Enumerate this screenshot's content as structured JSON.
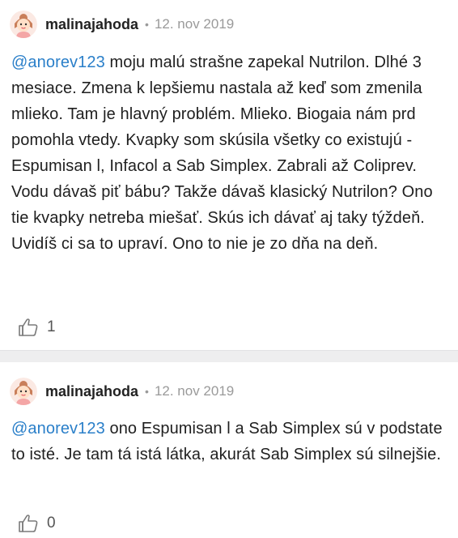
{
  "posts": [
    {
      "username": "malinajahoda",
      "separator": "•",
      "date": "12. nov 2019",
      "mention": "@anorev123",
      "text": " moju malú strašne zapekal Nutrilon. Dlhé 3 mesiace. Zmena k lepšiemu nastala až keď som zmenila mlieko. Tam je hlavný problém. Mlieko. Biogaia nám prd pomohla vtedy. Kvapky som skúsila všetky co existujú - Espumisan l, Infacol a Sab Simplex. Zabrali až Coliprev. Vodu dávaš piť bábu? Takže dávaš klasický Nutrilon? Ono tie kvapky netreba miešať. Skús ich dávať aj taky týždeň. Uvidíš ci sa to upraví. Ono to nie je zo dňa na deň.",
      "likes": "1",
      "avatar_icon": "girl-avatar-icon",
      "like_icon": "thumbs-up-icon"
    },
    {
      "username": "malinajahoda",
      "separator": "•",
      "date": "12. nov 2019",
      "mention": "@anorev123",
      "text": " ono Espumisan l a Sab Simplex sú v podstate to isté. Je tam tá istá látka, akurát Sab Simplex sú silnejšie.",
      "likes": "0",
      "avatar_icon": "girl-avatar-icon",
      "like_icon": "thumbs-up-icon"
    }
  ],
  "colors": {
    "mention": "#2a7fc9",
    "meta": "#9a9a9a",
    "divider": "#eeeeef"
  }
}
